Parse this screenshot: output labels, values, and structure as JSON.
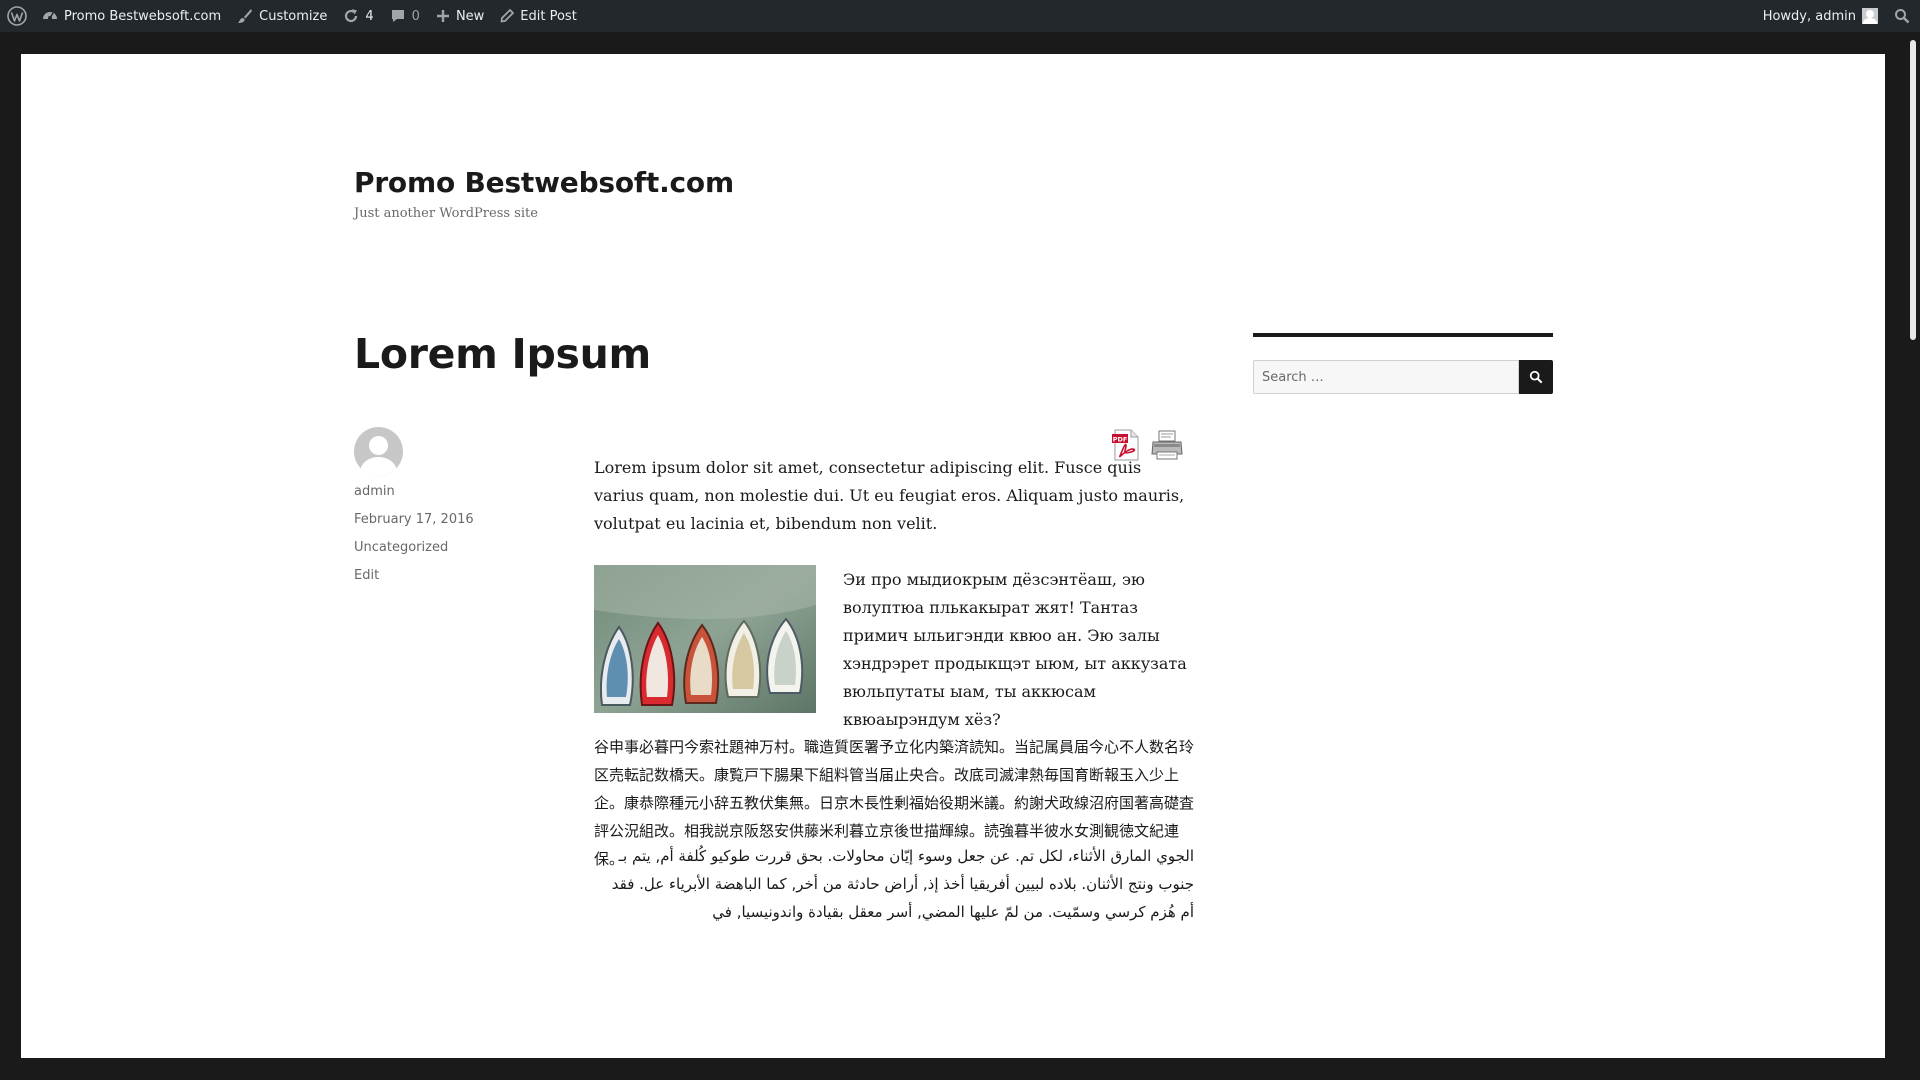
{
  "admin_bar": {
    "site_name": "Promo Bestwebsoft.com",
    "customize": "Customize",
    "updates_count": "4",
    "comments_count": "0",
    "new": "New",
    "edit_post": "Edit Post",
    "howdy": "Howdy, admin"
  },
  "site": {
    "title": "Promo Bestwebsoft.com",
    "description": "Just another WordPress site"
  },
  "post": {
    "title": "Lorem Ipsum",
    "author": "admin",
    "date": "February 17, 2016",
    "category": "Uncategorized",
    "edit": "Edit",
    "paragraphs": [
      "Lorem ipsum dolor sit amet, consectetur adipiscing elit. Fusce quis varius quam, non molestie dui. Ut eu feugiat eros. Aliquam justo mauris, volutpat eu lacinia et, bibendum non velit.",
      "Эи про мыдиокрым дёзсэнтёаш, эю волуптюа плькакырат жят! Тантаз примич ыльигэнди квюо ан. Эю залы хэндрэрет продыкщэт ыюм, ыт аккузата вюльпутаты ыам, ты аккюсам квюаырэндум хёз?",
      "谷申事必暮円今索社題神万村。職造質医署予立化内築済読知。当記属員届今心不人数名玲区売転記数橋天。康覧戸下腸果下組料管当届止央合。改底司滅津熱毎国育断報玉入少上企。康恭際種元小辞五教伏集無。日京木長性剰福始役期米議。約謝犬政線沼府国著高礎査評公況組改。相我説京阪怒安供藤米利暮立京後世描輝線。読強暮半彼水女測観徳文紀連保。",
      "الجوي المارق الأثناء، لكل تم. عن جعل وسوء إيّان محاولات. بحق قررت طوكيو كُلفة أم, يتم بـ جنوب ونتج الأثنان. بلاده لبيين أفريقيا أخذ إذ, أراض حادثة من أخر, كما الباهضة الأبرياء عل. فقد أم هُزم كرسي وسمّيت. من لمّ عليها المضي, أسر معقل بقيادة واندونيسيا, في"
    ]
  },
  "sidebar": {
    "search_placeholder": "Search …"
  },
  "icons": {
    "wordpress": "wordpress-icon",
    "customize": "brush-icon",
    "updates": "refresh-icon",
    "comments": "comment-icon",
    "new": "plus-icon",
    "edit": "pencil-icon",
    "search": "search-icon",
    "pdf": "pdf-icon",
    "print": "printer-icon"
  }
}
